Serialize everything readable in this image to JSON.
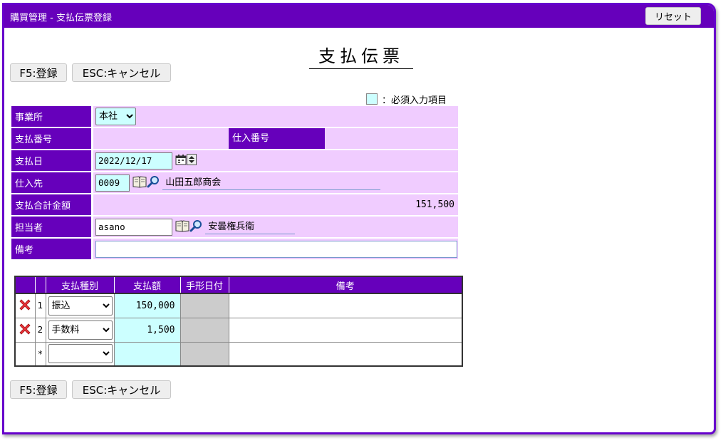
{
  "window": {
    "title": "購買管理 - 支払伝票登録"
  },
  "toolbar": {
    "reset_label": "リセット",
    "save_label": "F5:登録",
    "cancel_label": "ESC:キャンセル"
  },
  "page_title": "支払伝票",
  "legend": {
    "text": "：必須入力項目",
    "color": "#ccffff"
  },
  "form": {
    "office_label": "事業所",
    "office_value": "本社",
    "payment_no_label": "支払番号",
    "payment_no_value": "",
    "purchase_no_label": "仕入番号",
    "purchase_no_value": "",
    "payment_date_label": "支払日",
    "payment_date_value": "2022/12/17",
    "supplier_label": "仕入先",
    "supplier_code": "0009",
    "supplier_name": "山田五郎商会",
    "total_label": "支払合計金額",
    "total_value": "151,500",
    "staff_label": "担当者",
    "staff_code": "asano",
    "staff_name": "安曇権兵衛",
    "memo_label": "備考",
    "memo_value": ""
  },
  "grid": {
    "headers": [
      "",
      "",
      "支払種別",
      "支払額",
      "手形日付",
      "備考"
    ],
    "rows": [
      {
        "no": "1",
        "type": "振込",
        "amount": "150,000",
        "date": "",
        "memo": "",
        "deletable": true
      },
      {
        "no": "2",
        "type": "手数料",
        "amount": "1,500",
        "date": "",
        "memo": "",
        "deletable": true
      },
      {
        "no": "*",
        "type": "",
        "amount": "",
        "date": "",
        "memo": "",
        "deletable": false
      }
    ]
  },
  "colors": {
    "accent": "#6600bb",
    "row_bg": "#f0ccff",
    "required": "#ccffff"
  }
}
